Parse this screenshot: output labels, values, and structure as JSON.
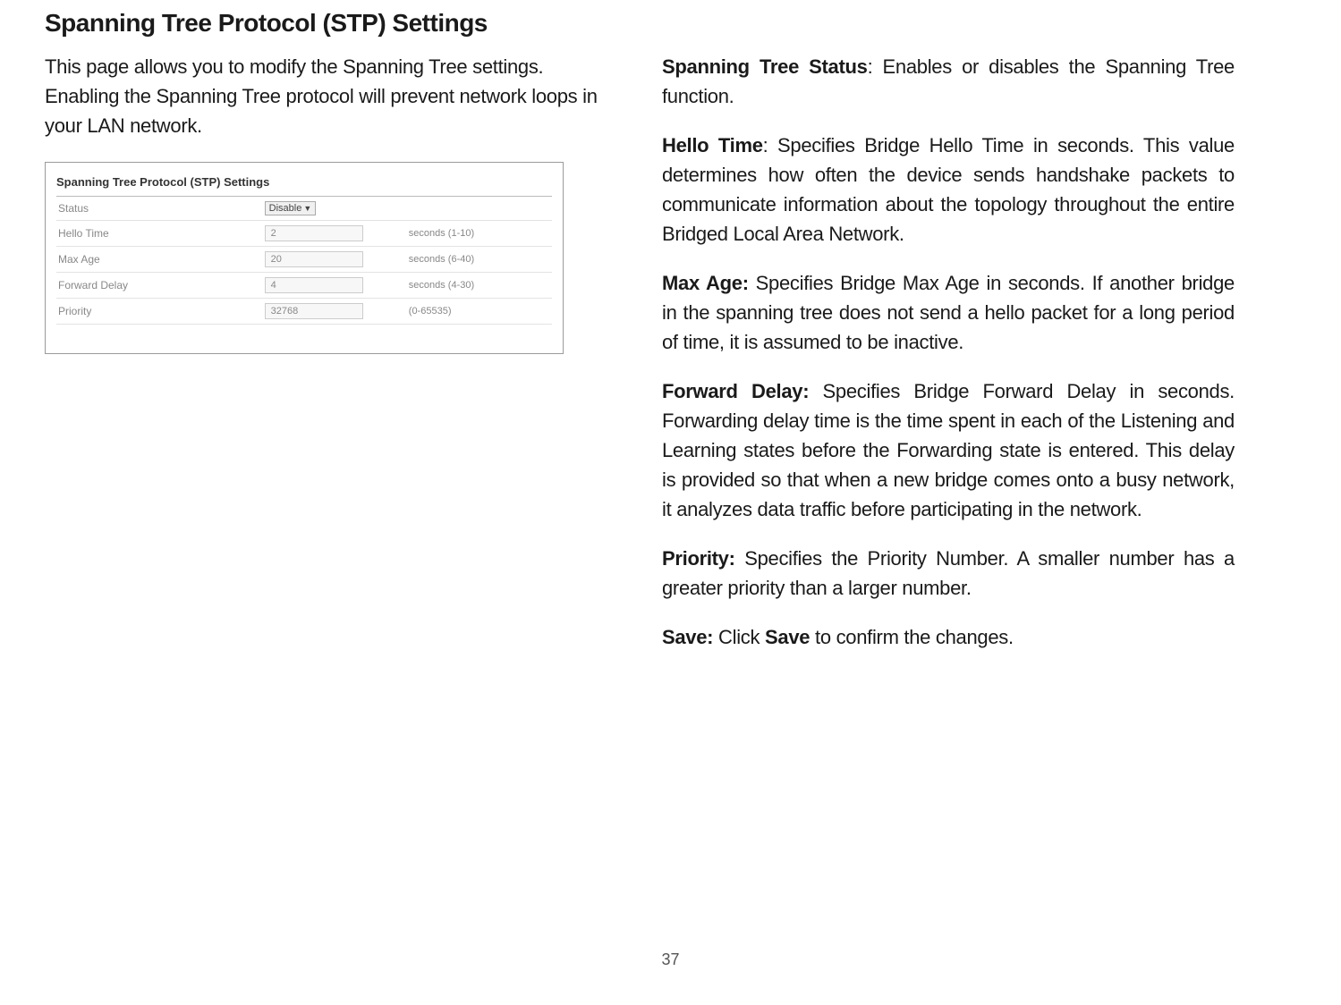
{
  "title": "Spanning Tree Protocol (STP) Settings",
  "intro": "This page allows you to modify the Spanning Tree settings. Enabling the Spanning Tree protocol will prevent network loops in your LAN network.",
  "screenshot": {
    "heading": "Spanning Tree Protocol (STP) Settings",
    "rows": [
      {
        "label": "Status",
        "value": "Disable",
        "type": "select",
        "hint": ""
      },
      {
        "label": "Hello Time",
        "value": "2",
        "type": "input",
        "hint": "seconds (1-10)"
      },
      {
        "label": "Max Age",
        "value": "20",
        "type": "input",
        "hint": "seconds (6-40)"
      },
      {
        "label": "Forward Delay",
        "value": "4",
        "type": "input",
        "hint": "seconds (4-30)"
      },
      {
        "label": "Priority",
        "value": "32768",
        "type": "input",
        "hint": "(0-65535)"
      }
    ]
  },
  "descriptions": {
    "status": {
      "term": "Spanning Tree Status",
      "text": ": Enables or disables the Spanning Tree function."
    },
    "hello": {
      "term": "Hello Time",
      "text": ": Specifies Bridge Hello Time in seconds. This value determines how often the device sends handshake packets to communicate information about the topology throughout the entire Bridged Local Area Network."
    },
    "maxage": {
      "term": "Max Age:",
      "text": " Specifies Bridge Max Age in seconds. If another bridge in the spanning tree does not send a hello packet for a long period of time, it is assumed to be inactive."
    },
    "forward": {
      "term": "Forward Delay:",
      "text": " Specifies Bridge Forward Delay in seconds. Forwarding delay time is the time spent in each of the Listening and Learning states before the Forwarding state is entered. This delay is provided so that when a new bridge comes onto a busy network, it analyzes data traffic before participating in the network."
    },
    "priority": {
      "term": "Priority:",
      "text": " Specifies the Priority Number. A smaller number has a greater priority than a larger number."
    },
    "save": {
      "term": "Save:",
      "text_before": " Click ",
      "term2": "Save",
      "text_after": " to confirm the changes."
    }
  },
  "page_number": "37"
}
